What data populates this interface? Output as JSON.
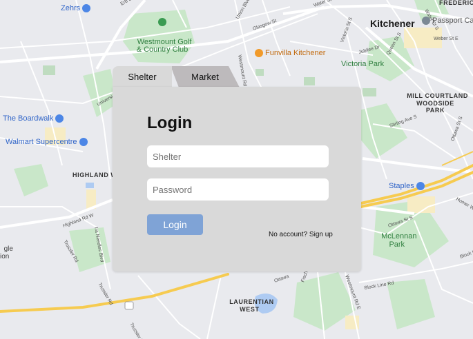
{
  "tabs": [
    {
      "label": "Shelter",
      "active": true
    },
    {
      "label": "Market",
      "active": false
    }
  ],
  "login": {
    "title": "Login",
    "shelter_placeholder": "Shelter",
    "password_placeholder": "Password",
    "button_label": "Login",
    "signup_text": "No account? Sign up"
  },
  "map_labels": {
    "zehrs": "Zehrs",
    "westmount": "Westmount Golf\n& Country Club",
    "funvilla": "Funvilla Kitchener",
    "kitchener": "Kitchener",
    "passport": "Passport Cana",
    "victoria_park": "Victoria Park",
    "mill_courtland": "MILL COURTLAND\nWOODSIDE\nPARK",
    "boardwalk": "The Boardwalk",
    "walmart": "Walmart Supercentre",
    "highland_west": "HIGHLAND WE",
    "staples": "Staples",
    "mclennan": "McLennan\nPark",
    "laurentian": "LAURENTIAN\nWEST",
    "frederick": "FREDERICK",
    "gle": "gle\nion"
  },
  "colors": {
    "map_bg": "#e9eaee",
    "park": "#c7e6c8",
    "highway": "#f6c84a",
    "card": "#d9d9d9",
    "login_button": "#7fa3d6"
  }
}
